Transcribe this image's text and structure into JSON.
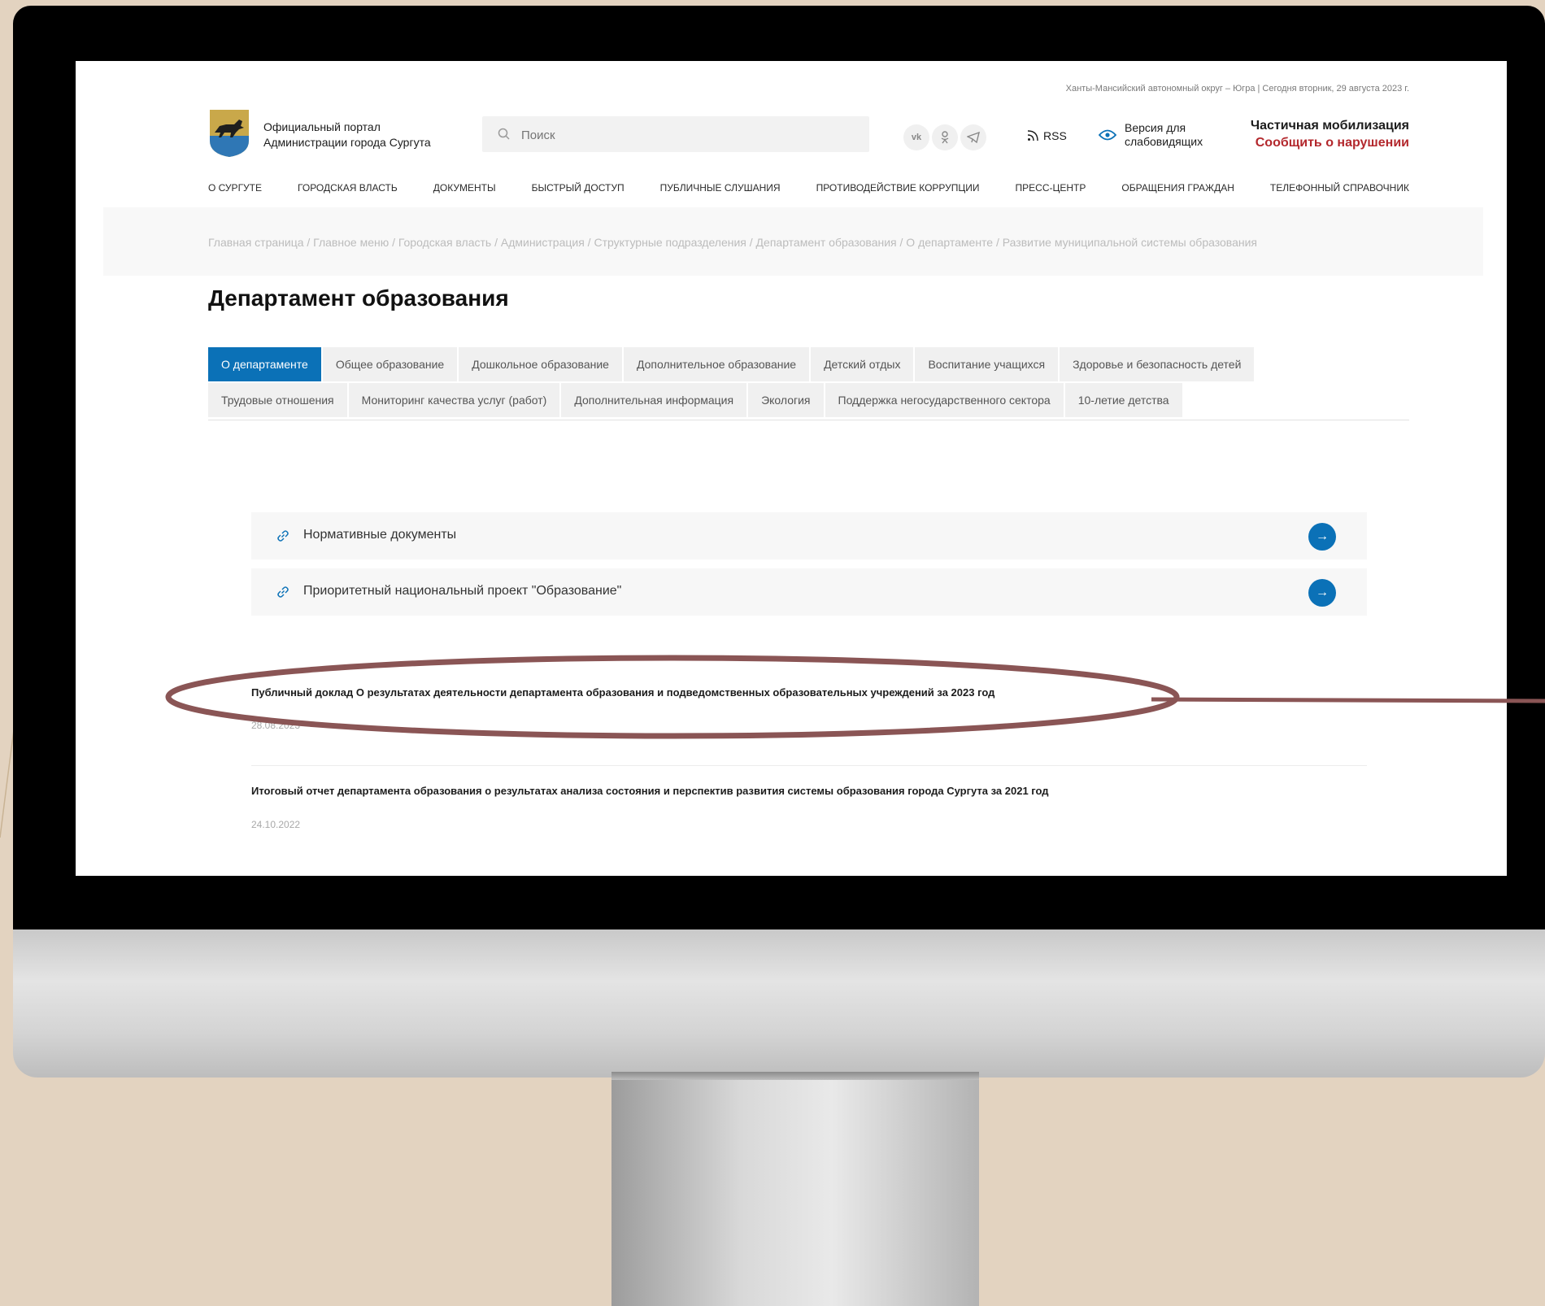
{
  "header": {
    "region_date": "Ханты-Мансийский автономный округ – Югра | Сегодня вторник, 29 августа 2023 г.",
    "portal_line1": "Официальный портал",
    "portal_line2": "Администрации города Сургута",
    "search_placeholder": "Поиск",
    "social": [
      "vk",
      "ok",
      "telegram"
    ],
    "rss": "RSS",
    "vision_line1": "Версия для",
    "vision_line2": "слабовидящих",
    "mobilization": "Частичная мобилизация",
    "report_violation": "Сообщить о нарушении"
  },
  "nav": [
    "О СУРГУТЕ",
    "ГОРОДСКАЯ ВЛАСТЬ",
    "ДОКУМЕНТЫ",
    "БЫСТРЫЙ ДОСТУП",
    "ПУБЛИЧНЫЕ СЛУШАНИЯ",
    "ПРОТИВОДЕЙСТВИЕ КОРРУПЦИИ",
    "ПРЕСС-ЦЕНТР",
    "ОБРАЩЕНИЯ ГРАЖДАН",
    "ТЕЛЕФОННЫЙ СПРАВОЧНИК"
  ],
  "breadcrumb": "Главная страница / Главное меню / Городская власть / Администрация / Структурные подразделения / Департамент образования / О департаменте / Развитие муниципальной системы образования",
  "page_title": "Департамент образования",
  "tabs_row1": [
    "О департаменте",
    "Общее образование",
    "Дошкольное образование",
    "Дополнительное образование",
    "Детский отдых",
    "Воспитание учащихся",
    "Здоровье и безопасность детей"
  ],
  "tabs_row2": [
    "Трудовые отношения",
    "Мониторинг качества услуг (работ)",
    "Дополнительная информация",
    "Экология",
    "Поддержка негосударственного сектора",
    "10-летие детства"
  ],
  "links": [
    "Нормативные документы",
    "Приоритетный национальный проект \"Образование\""
  ],
  "documents": [
    {
      "title": "Публичный доклад О результатах деятельности департамента образования и подведомственных образовательных учреждений за 2023 год",
      "date": "28.08.2023"
    },
    {
      "title": "Итоговый отчет департамента образования о результатах анализа состояния и перспектив развития системы образования города Сургута за 2021 год",
      "date": "24.10.2022"
    }
  ],
  "colors": {
    "accent": "#0b71b7",
    "alert": "#b3282d",
    "highlight": "#8a5555"
  }
}
